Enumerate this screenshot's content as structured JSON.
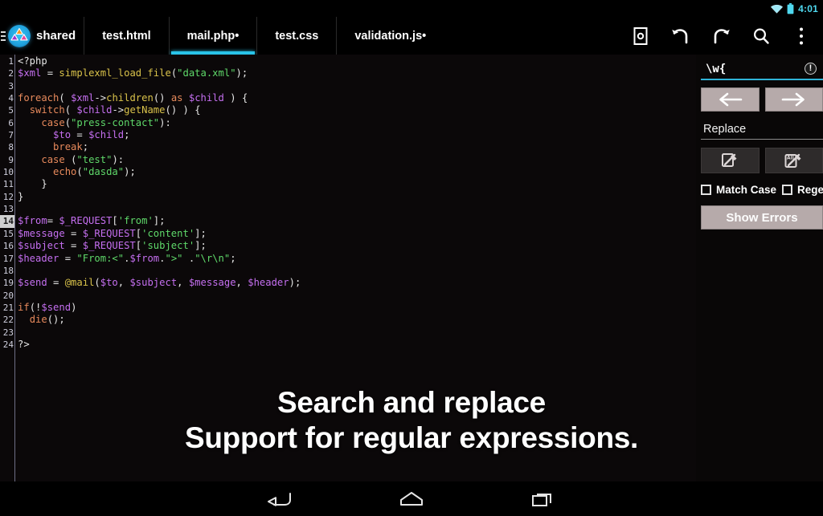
{
  "statusbar": {
    "time": "4:01",
    "icons": [
      "wifi-icon",
      "battery-icon"
    ]
  },
  "actionbar": {
    "drawer_handle": "drawer-handle",
    "brand_label": "shared",
    "brand_logo": "app-logo-icon",
    "tabs": [
      {
        "label": "test.html",
        "modified": false,
        "active": false
      },
      {
        "label": "mail.php•",
        "modified": true,
        "active": true
      },
      {
        "label": "test.css",
        "modified": false,
        "active": false
      },
      {
        "label": "validation.js•",
        "modified": true,
        "active": false
      }
    ],
    "icons": [
      {
        "name": "save-icon",
        "title": "Save"
      },
      {
        "name": "undo-icon",
        "title": "Undo"
      },
      {
        "name": "redo-icon",
        "title": "Redo"
      },
      {
        "name": "search-icon",
        "title": "Search"
      },
      {
        "name": "overflow-menu-icon",
        "title": "More options"
      }
    ]
  },
  "editor": {
    "current_line": 14,
    "total_lines": 24,
    "line_numbers": [
      1,
      2,
      3,
      4,
      5,
      6,
      7,
      8,
      9,
      10,
      11,
      12,
      13,
      14,
      15,
      16,
      17,
      18,
      19,
      20,
      21,
      22,
      23,
      24
    ],
    "lines": [
      "<?php",
      "$xml = simplexml_load_file(\"data.xml\");",
      "",
      "foreach( $xml->children() as $child ) {",
      "  switch( $child->getName() ) {",
      "    case(\"press-contact\"):",
      "      $to = $child;",
      "      break;",
      "    case (\"test\"):",
      "      echo(\"dasda\");",
      "    }",
      "}",
      "",
      "$from= $_REQUEST['from'];",
      "$message = $_REQUEST['content'];",
      "$subject = $_REQUEST['subject'];",
      "$header = \"From:<\".$from.\">\" .\"\\r\\n\";",
      "",
      "$send = @mail($to, $subject, $message, $header);",
      "",
      "if(!$send)",
      "  die();",
      "",
      "?>"
    ]
  },
  "search_panel": {
    "search_value": "\\w{",
    "search_error_icon": "error-badge-icon",
    "prev_icon": "arrow-left-icon",
    "next_icon": "arrow-right-icon",
    "replace_placeholder": "Replace",
    "replace_value": "",
    "replace_icon": "replace-one-icon",
    "replace_all_icon": "replace-all-icon",
    "match_case_label": "Match Case",
    "match_case_checked": false,
    "regex_label": "Regex",
    "regex_checked": false,
    "show_errors_label": "Show Errors"
  },
  "caption": {
    "line1": "Search and replace",
    "line2": "Support for regular expressions."
  },
  "navbar": {
    "back_icon": "back-nav-icon",
    "home_icon": "home-nav-icon",
    "recents_icon": "recents-nav-icon"
  },
  "colors": {
    "accent": "#29c3e8",
    "editor_bg": "#0b0809",
    "keyword": "#e88a5c",
    "variable": "#c56ff0",
    "function": "#d9c24a",
    "string": "#5fd96a",
    "button_face": "#b6aaaa"
  }
}
